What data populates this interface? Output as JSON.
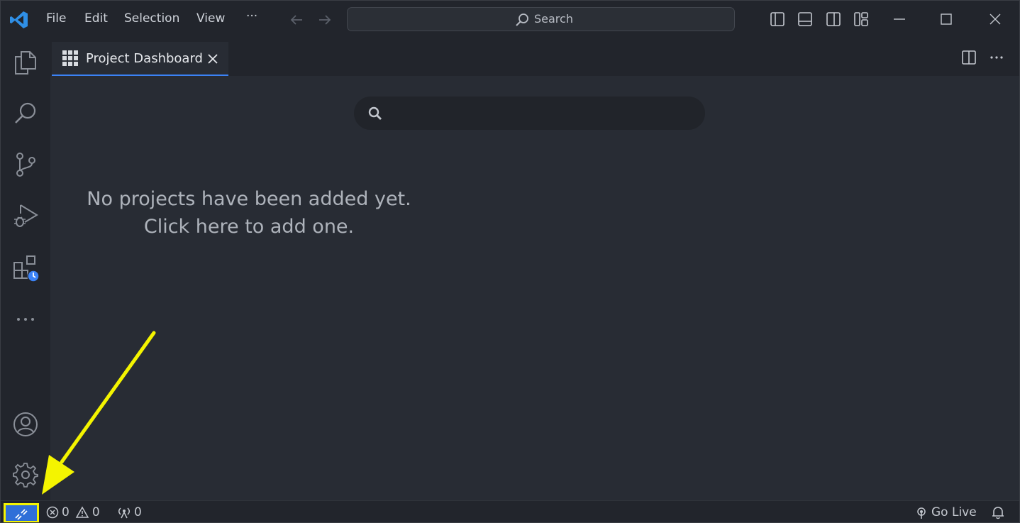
{
  "titlebar": {
    "menu": [
      "File",
      "Edit",
      "Selection",
      "View"
    ],
    "more_label": "···",
    "search_label": "Search"
  },
  "tab": {
    "label": "Project Dashboard"
  },
  "dashboard": {
    "search_placeholder": "",
    "empty_line1": "No projects have been added yet.",
    "empty_line2": "Click here to add one."
  },
  "statusbar": {
    "errors": "0",
    "warnings": "0",
    "ports": "0",
    "go_live": "Go Live"
  },
  "colors": {
    "accent": "#3b82f6",
    "remote_bg": "#2f6fd8",
    "highlight": "#f4f400",
    "background": "#282c34"
  },
  "icons": [
    "vscode-logo",
    "explorer-icon",
    "search-icon",
    "source-control-icon",
    "run-debug-icon",
    "extensions-icon",
    "account-icon",
    "gear-icon",
    "remote-icon",
    "bell-icon"
  ]
}
